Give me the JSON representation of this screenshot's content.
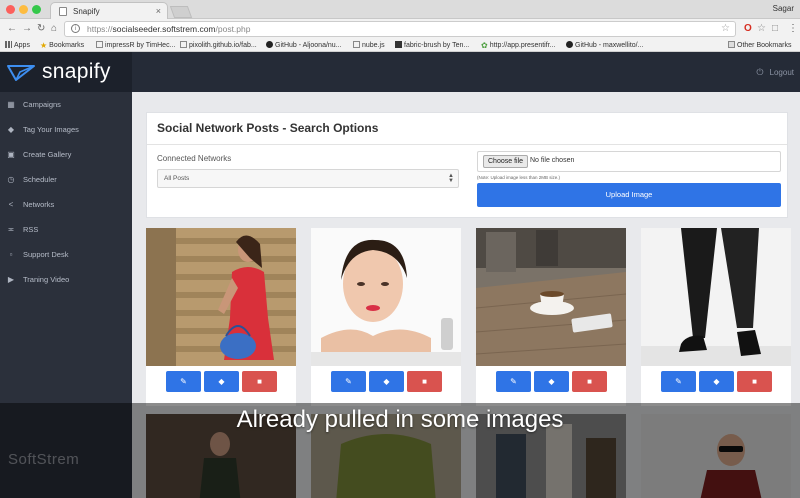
{
  "browser": {
    "tab_title": "Snapify",
    "tab_close": "×",
    "profile": "Sagar",
    "url_host": "socialseeder.softstrem.com",
    "url_path": "/post.php",
    "url_scheme": "https://",
    "bookmarks": [
      {
        "label": "Apps"
      },
      {
        "label": "Bookmarks"
      },
      {
        "label": "impressR by TimHec..."
      },
      {
        "label": "pixolith.github.io/fab..."
      },
      {
        "label": "GitHub - Aljoona/nu..."
      },
      {
        "label": "nube.js"
      },
      {
        "label": "fabric-brush by Ten..."
      },
      {
        "label": "http://app.presentifr..."
      },
      {
        "label": "GitHub - maxwellito/..."
      },
      {
        "label": "Other Bookmarks"
      }
    ]
  },
  "app": {
    "logo_text": "snapify",
    "logout_label": "Logout",
    "brand_color": "#2f74e6"
  },
  "sidebar": {
    "items": [
      {
        "label": "Campaigns",
        "icon": "grid-icon"
      },
      {
        "label": "Tag Your Images",
        "icon": "tag-icon"
      },
      {
        "label": "Create Gallery",
        "icon": "gallery-icon"
      },
      {
        "label": "Scheduler",
        "icon": "clock-icon"
      },
      {
        "label": "Networks",
        "icon": "share-icon"
      },
      {
        "label": "RSS",
        "icon": "rss-icon"
      },
      {
        "label": "Support Desk",
        "icon": "chat-icon"
      },
      {
        "label": "Traning Video",
        "icon": "video-icon"
      }
    ]
  },
  "search_card": {
    "title": "Social Network Posts - Search Options",
    "networks_label": "Connected Networks",
    "networks_selected": "All Posts",
    "file_button": "Choose file",
    "file_status": "No file chosen",
    "file_note": "(Note: Upload image less than 2MB size.)",
    "upload_button": "Upload Image"
  },
  "tiles": [
    {
      "subject": "woman in red dress with blue handbag on stairs"
    },
    {
      "subject": "woman face resting on hands"
    },
    {
      "subject": "coffee cup and phone on wooden table"
    },
    {
      "subject": "legs in black trousers and loafers"
    }
  ],
  "caption": "Already pulled in some images",
  "watermark": "SoftStrem"
}
